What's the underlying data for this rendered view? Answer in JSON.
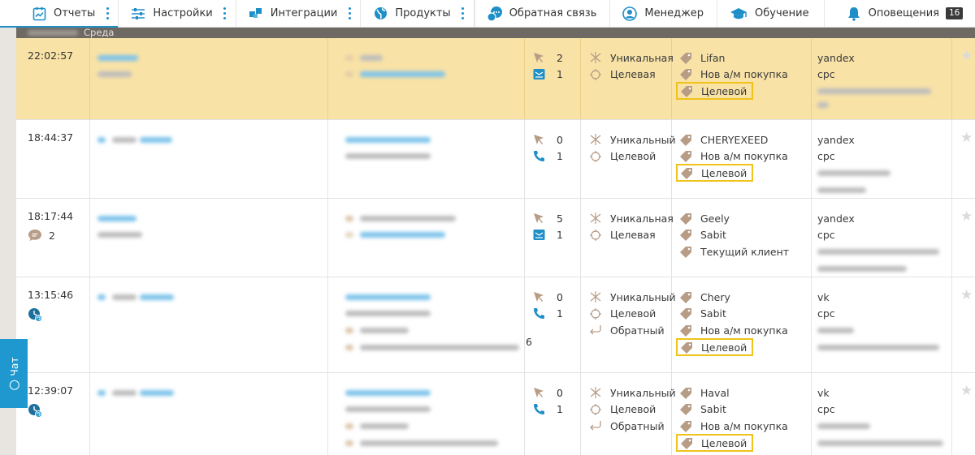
{
  "nav": {
    "reports": "Отчеты",
    "settings": "Настройки",
    "integrations": "Интеграции",
    "products": "Продукты",
    "feedback": "Обратная связь",
    "manager": "Менеджер",
    "training": "Обучение",
    "notifications": "Оповещения",
    "notifications_count": "16"
  },
  "datebar": {
    "weekday": "Среда"
  },
  "chat_tab": {
    "label": "Чат"
  },
  "colors": {
    "accent": "#1f8fc7",
    "highlight_row": "#f8e2a6",
    "tag_outline": "#f0c21a",
    "tag_icon": "#b79c86"
  },
  "rows": [
    {
      "time": "22:02:57",
      "act": {
        "clicks": "2",
        "second": "1",
        "second_icon": "mail-icon"
      },
      "types": [
        "Уникальная",
        "Целевая"
      ],
      "tags": [
        "Lifan",
        "Нов а/м покупка",
        "Целевой"
      ],
      "source": [
        "yandex",
        "cpc"
      ]
    },
    {
      "time": "18:44:37",
      "act": {
        "clicks": "0",
        "second": "1",
        "second_icon": "phone-icon"
      },
      "types": [
        "Уникальный",
        "Целевой"
      ],
      "tags": [
        "CHERYEXEED",
        "Нов а/м покупка",
        "Целевой"
      ],
      "source": [
        "yandex",
        "cpc"
      ]
    },
    {
      "time": "18:17:44",
      "chat_count": "2",
      "act": {
        "clicks": "5",
        "second": "1",
        "second_icon": "mail-icon"
      },
      "types": [
        "Уникальная",
        "Целевая"
      ],
      "tags": [
        "Geely",
        "Sabit",
        "Текущий клиент"
      ],
      "source": [
        "yandex",
        "cpc"
      ]
    },
    {
      "time": "13:15:46",
      "act": {
        "clicks": "0",
        "second": "1",
        "second_icon": "phone-icon"
      },
      "types": [
        "Уникальный",
        "Целевой",
        "Обратный"
      ],
      "tags": [
        "Chery",
        "Sabit",
        "Нов а/м покупка",
        "Целевой"
      ],
      "source": [
        "vk",
        "cpc"
      ],
      "contact_extra": "6"
    },
    {
      "time": "12:39:07",
      "act": {
        "clicks": "0",
        "second": "1",
        "second_icon": "phone-icon"
      },
      "types": [
        "Уникальный",
        "Целевой",
        "Обратный"
      ],
      "tags": [
        "Haval",
        "Sabit",
        "Нов а/м покупка",
        "Целевой"
      ],
      "source": [
        "vk",
        "cpc"
      ]
    }
  ]
}
